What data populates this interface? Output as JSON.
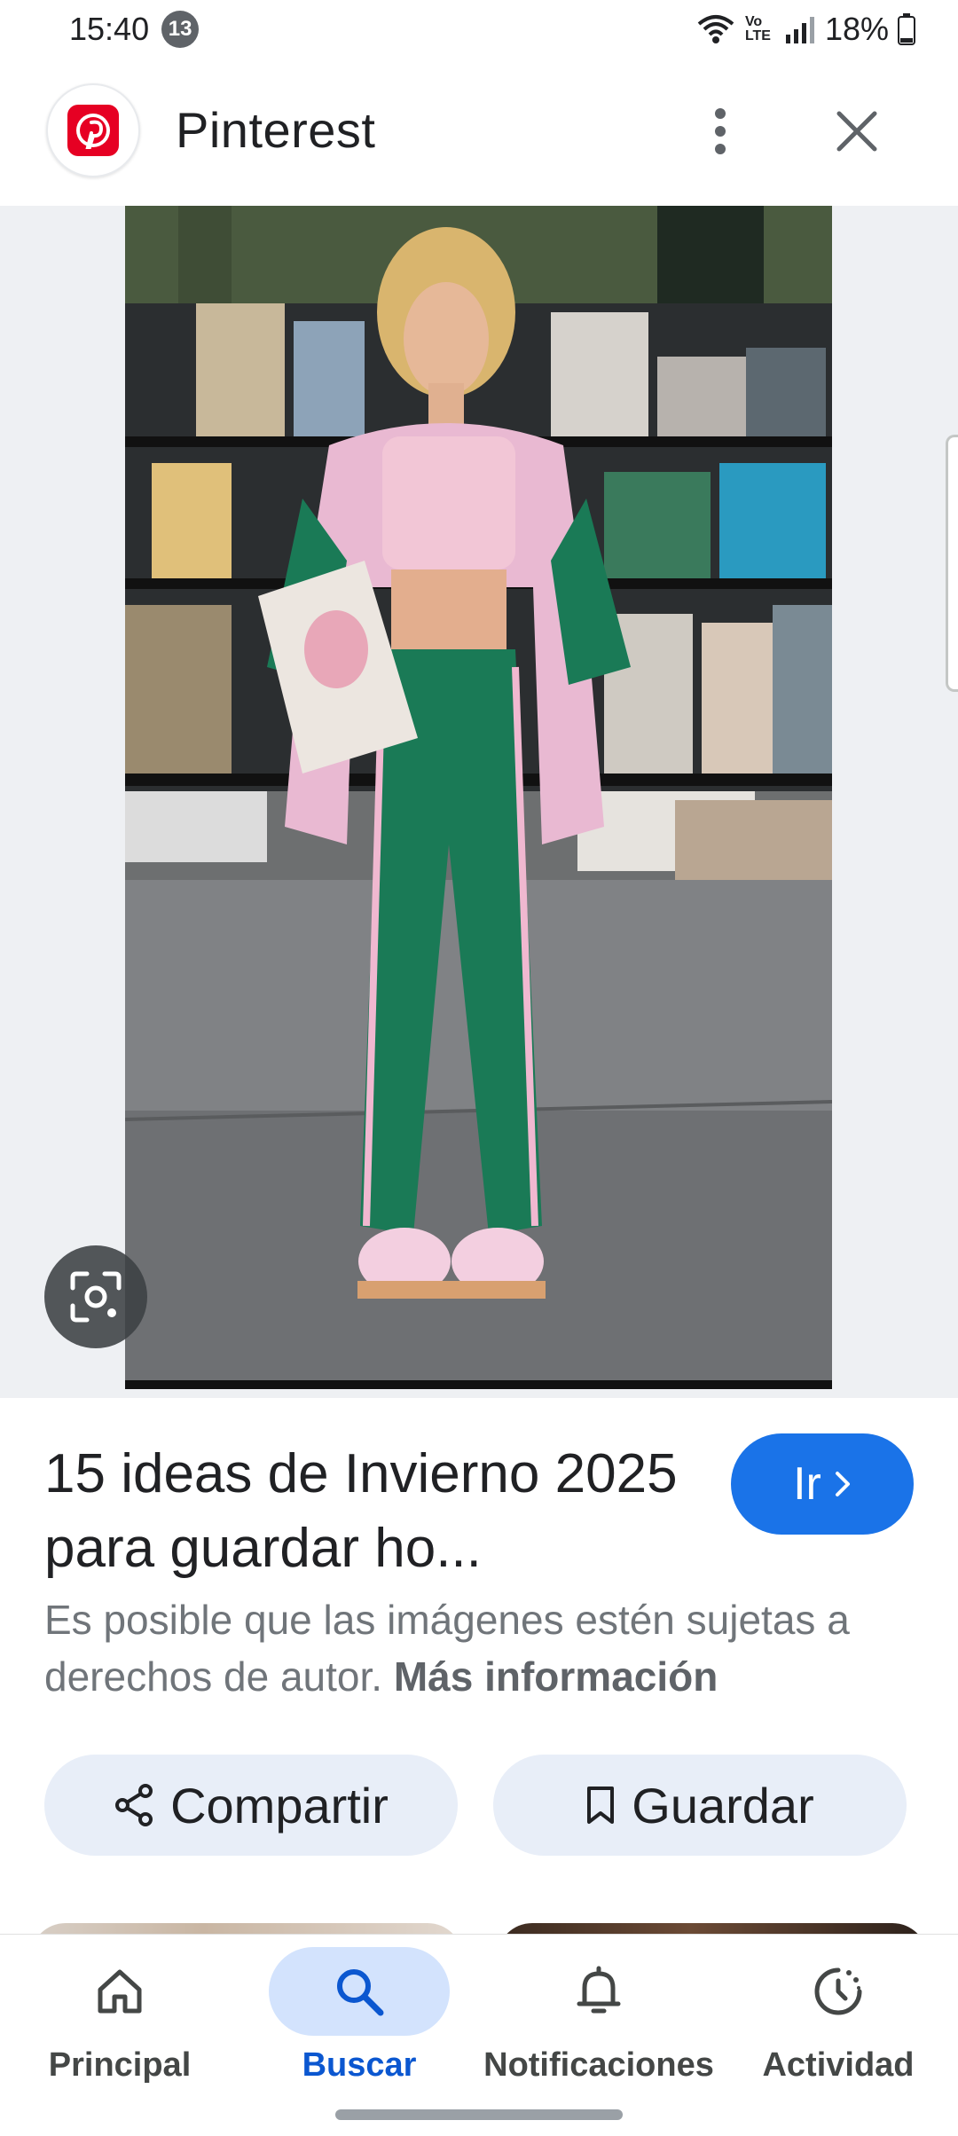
{
  "status_bar": {
    "time": "15:40",
    "notification_count": "13",
    "network_label": "Vo LTE",
    "battery": "18%"
  },
  "header": {
    "title": "Pinterest",
    "logo_icon": "pinterest-logo",
    "more_icon": "more-vert-icon",
    "close_icon": "close-icon"
  },
  "image": {
    "lens_icon": "google-lens-icon"
  },
  "result": {
    "title": "15 ideas de Invierno 2025 para guardar ho...",
    "go_label": "Ir",
    "copyright_text": "Es posible que las imágenes estén sujetas a derechos de autor.",
    "more_info_label": "Más información"
  },
  "actions": {
    "share_label": "Compartir",
    "save_label": "Guardar"
  },
  "bottom_nav": {
    "items": [
      {
        "label": "Principal",
        "icon": "home-icon"
      },
      {
        "label": "Buscar",
        "icon": "search-icon",
        "active": true
      },
      {
        "label": "Notificaciones",
        "icon": "bell-icon"
      },
      {
        "label": "Actividad",
        "icon": "activity-icon"
      }
    ]
  },
  "colors": {
    "accent": "#1a73e8",
    "active_nav": "#0b57d0",
    "pinterest_red": "#e60023",
    "chip_bg": "#e8eef8"
  }
}
